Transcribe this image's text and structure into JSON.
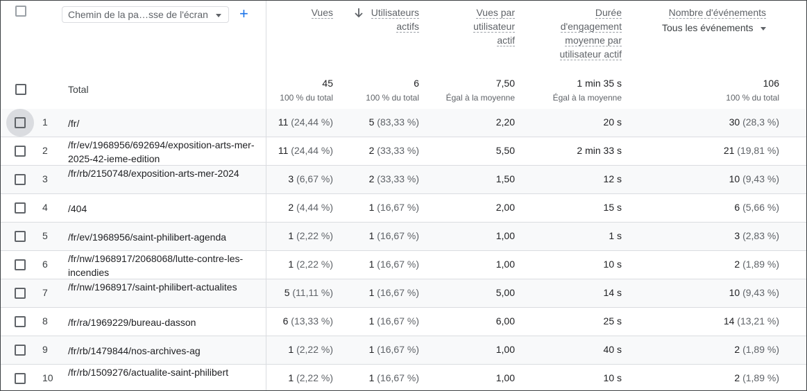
{
  "header": {
    "dimension_label": "Chemin de la pa…sse de l'écran",
    "add_icon": "+",
    "columns": [
      {
        "key": "vues",
        "lines": [
          "Vues"
        ]
      },
      {
        "key": "utilisateurs",
        "lines": [
          "Utilisateurs",
          "actifs"
        ],
        "sorted": "desc"
      },
      {
        "key": "vues_par_user",
        "lines": [
          "Vues par",
          "utilisateur",
          "actif"
        ]
      },
      {
        "key": "duree",
        "lines": [
          "Durée",
          "d'engagement",
          "moyenne par",
          "utilisateur actif"
        ]
      },
      {
        "key": "evenements",
        "lines": [
          "Nombre d'événements"
        ],
        "filter": "Tous les événements"
      }
    ]
  },
  "totals": {
    "label": "Total",
    "vues": {
      "value": "45",
      "sub": "100 % du total"
    },
    "utilisateurs": {
      "value": "6",
      "sub": "100 % du total"
    },
    "vues_par_user": {
      "value": "7,50",
      "sub": "Égal à la moyenne"
    },
    "duree": {
      "value": "1 min 35 s",
      "sub": "Égal à la moyenne"
    },
    "evenements": {
      "value": "106",
      "sub": "100 % du total"
    }
  },
  "rows": [
    {
      "n": "1",
      "path": "/fr/",
      "vues": "11",
      "vues_pct": "(24,44 %)",
      "users": "5",
      "users_pct": "(83,33 %)",
      "vpu": "2,20",
      "duree": "20 s",
      "ev": "30",
      "ev_pct": "(28,3 %)"
    },
    {
      "n": "2",
      "path": "/fr/ev/1968956/692694/exposition-arts-mer-2025-42-ieme-edition",
      "vues": "11",
      "vues_pct": "(24,44 %)",
      "users": "2",
      "users_pct": "(33,33 %)",
      "vpu": "5,50",
      "duree": "2 min 33 s",
      "ev": "21",
      "ev_pct": "(19,81 %)"
    },
    {
      "n": "3",
      "path": "/fr/rb/2150748/exposition-arts-mer-2024",
      "vues": "3",
      "vues_pct": "(6,67 %)",
      "users": "2",
      "users_pct": "(33,33 %)",
      "vpu": "1,50",
      "duree": "12 s",
      "ev": "10",
      "ev_pct": "(9,43 %)"
    },
    {
      "n": "4",
      "path": "/404",
      "vues": "2",
      "vues_pct": "(4,44 %)",
      "users": "1",
      "users_pct": "(16,67 %)",
      "vpu": "2,00",
      "duree": "15 s",
      "ev": "6",
      "ev_pct": "(5,66 %)"
    },
    {
      "n": "5",
      "path": "/fr/ev/1968956/saint-philibert-agenda",
      "vues": "1",
      "vues_pct": "(2,22 %)",
      "users": "1",
      "users_pct": "(16,67 %)",
      "vpu": "1,00",
      "duree": "1 s",
      "ev": "3",
      "ev_pct": "(2,83 %)"
    },
    {
      "n": "6",
      "path": "/fr/nw/1968917/2068068/lutte-contre-les-incendies",
      "vues": "1",
      "vues_pct": "(2,22 %)",
      "users": "1",
      "users_pct": "(16,67 %)",
      "vpu": "1,00",
      "duree": "10 s",
      "ev": "2",
      "ev_pct": "(1,89 %)"
    },
    {
      "n": "7",
      "path": "/fr/nw/1968917/saint-philibert-actualites",
      "vues": "5",
      "vues_pct": "(11,11 %)",
      "users": "1",
      "users_pct": "(16,67 %)",
      "vpu": "5,00",
      "duree": "14 s",
      "ev": "10",
      "ev_pct": "(9,43 %)"
    },
    {
      "n": "8",
      "path": "/fr/ra/1969229/bureau-dasson",
      "vues": "6",
      "vues_pct": "(13,33 %)",
      "users": "1",
      "users_pct": "(16,67 %)",
      "vpu": "6,00",
      "duree": "25 s",
      "ev": "14",
      "ev_pct": "(13,21 %)"
    },
    {
      "n": "9",
      "path": "/fr/rb/1479844/nos-archives-ag",
      "vues": "1",
      "vues_pct": "(2,22 %)",
      "users": "1",
      "users_pct": "(16,67 %)",
      "vpu": "1,00",
      "duree": "40 s",
      "ev": "2",
      "ev_pct": "(1,89 %)"
    },
    {
      "n": "10",
      "path": "/fr/rb/1509276/actualite-saint-philibert",
      "vues": "1",
      "vues_pct": "(2,22 %)",
      "users": "1",
      "users_pct": "(16,67 %)",
      "vpu": "1,00",
      "duree": "10 s",
      "ev": "2",
      "ev_pct": "(1,89 %)"
    }
  ]
}
